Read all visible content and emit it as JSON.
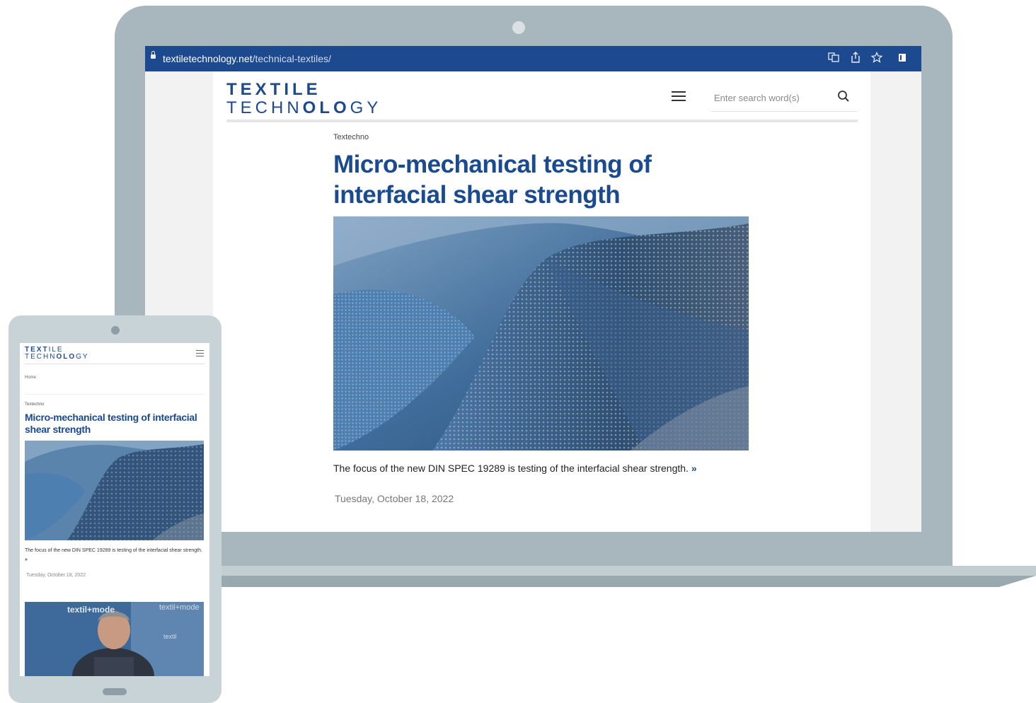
{
  "browser": {
    "url_domain": "textiletechnology.net",
    "url_path": "/technical-textiles/"
  },
  "site": {
    "logo_line1": "TEXTILE",
    "logo_line2_a": "TECHN",
    "logo_line2_b": "OLO",
    "logo_line2_c": "GY",
    "search_placeholder": "Enter search word(s)"
  },
  "article": {
    "kicker": "Textechno",
    "title": "Micro-mechanical testing of interfacial shear strength",
    "teaser": "The focus of the new DIN SPEC 19289 is testing of the interfacial shear strength.",
    "more_glyph": "»",
    "date": "Tuesday, October 18, 2022"
  },
  "tablet": {
    "logo_line1_a": "TEXT",
    "logo_line1_b": "ILE",
    "logo_line2_a": "TECHN",
    "logo_line2_b": "OLO",
    "logo_line2_c": "GY",
    "breadcrumb": "Home",
    "kicker": "Textechno",
    "title": "Micro-mechanical testing of interfacial shear strength",
    "teaser": "The focus of the new DIN SPEC 19289 is testing of the interfacial shear strength.",
    "more_glyph": "»",
    "date": "Tuesday, October 18, 2022",
    "video_brand": "textil+mode",
    "video_brand2": "textil+mode",
    "video_brand3": "textil"
  },
  "colors": {
    "brand_blue": "#1d4a8e",
    "headline_blue": "#1a4a8f",
    "device_frame": "#a8b6bd"
  }
}
